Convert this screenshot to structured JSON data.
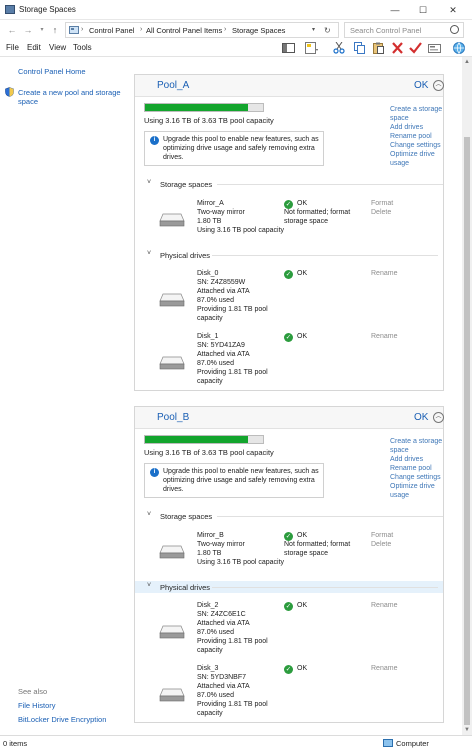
{
  "window": {
    "title": "Storage Spaces",
    "minimize": "—",
    "maximize": "☐",
    "close": "✕"
  },
  "address": {
    "crumbs": [
      "Control Panel",
      "All Control Panel Items",
      "Storage Spaces"
    ],
    "search_placeholder": "Search Control Panel"
  },
  "menu": [
    "File",
    "Edit",
    "View",
    "Tools"
  ],
  "sidebar": {
    "home": "Control Panel Home",
    "create": "Create a new pool and storage space",
    "see_also": "See also",
    "links": [
      "File History",
      "BitLocker Drive Encryption"
    ]
  },
  "pools": [
    {
      "name": "Pool_A",
      "status": "OK",
      "usage_fraction": 0.87,
      "usage_text": "Using 3.16 TB of 3.63 TB pool capacity",
      "upgrade_text": "Upgrade this pool to enable new features, such as optimizing drive usage and safely removing extra drives.",
      "actions": [
        "Create a storage space",
        "Add drives",
        "Rename pool",
        "Change settings",
        "Optimize drive usage"
      ],
      "storage_spaces_label": "Storage spaces",
      "physical_drives_label": "Physical drives",
      "spaces": [
        {
          "name": "Mirror_A",
          "type": "Two-way mirror",
          "size": "1.80 TB",
          "usage": "Using 3.16 TB pool capacity",
          "status": "OK",
          "note": "Not formatted; format storage space",
          "actions": [
            "Format",
            "Delete"
          ]
        }
      ],
      "drives": [
        {
          "name": "Disk_0",
          "sn": "SN: Z4Z8559W",
          "attached": "Attached via ATA",
          "used": "87.0% used",
          "providing": "Providing 1.81 TB pool capacity",
          "status": "OK",
          "action": "Rename"
        },
        {
          "name": "Disk_1",
          "sn": "SN: 5YD41ZA9",
          "attached": "Attached via ATA",
          "used": "87.0% used",
          "providing": "Providing 1.81 TB pool capacity",
          "status": "OK",
          "action": "Rename"
        }
      ]
    },
    {
      "name": "Pool_B",
      "status": "OK",
      "usage_fraction": 0.87,
      "usage_text": "Using 3.16 TB of 3.63 TB pool capacity",
      "upgrade_text": "Upgrade this pool to enable new features, such as optimizing drive usage and safely removing extra drives.",
      "actions": [
        "Create a storage space",
        "Add drives",
        "Rename pool",
        "Change settings",
        "Optimize drive usage"
      ],
      "storage_spaces_label": "Storage spaces",
      "physical_drives_label": "Physical drives",
      "spaces": [
        {
          "name": "Mirror_B",
          "type": "Two-way mirror",
          "size": "1.80 TB",
          "usage": "Using 3.16 TB pool capacity",
          "status": "OK",
          "note": "Not formatted; format storage space",
          "actions": [
            "Format",
            "Delete"
          ]
        }
      ],
      "drives": [
        {
          "name": "Disk_2",
          "sn": "SN: Z4ZC6E1C",
          "attached": "Attached via ATA",
          "used": "87.0% used",
          "providing": "Providing 1.81 TB pool capacity",
          "status": "OK",
          "action": "Rename"
        },
        {
          "name": "Disk_3",
          "sn": "SN: 5YD3NBF7",
          "attached": "Attached via ATA",
          "used": "87.0% used",
          "providing": "Providing 1.81 TB pool capacity",
          "status": "OK",
          "action": "Rename"
        }
      ]
    }
  ],
  "statusbar": {
    "items": "0 items",
    "computer": "Computer"
  },
  "colors": {
    "link": "#1a5fb4",
    "bar_fill": "#13a52d",
    "ok_green": "#2c9c3e",
    "disabled_action": "#8c8c8c"
  }
}
